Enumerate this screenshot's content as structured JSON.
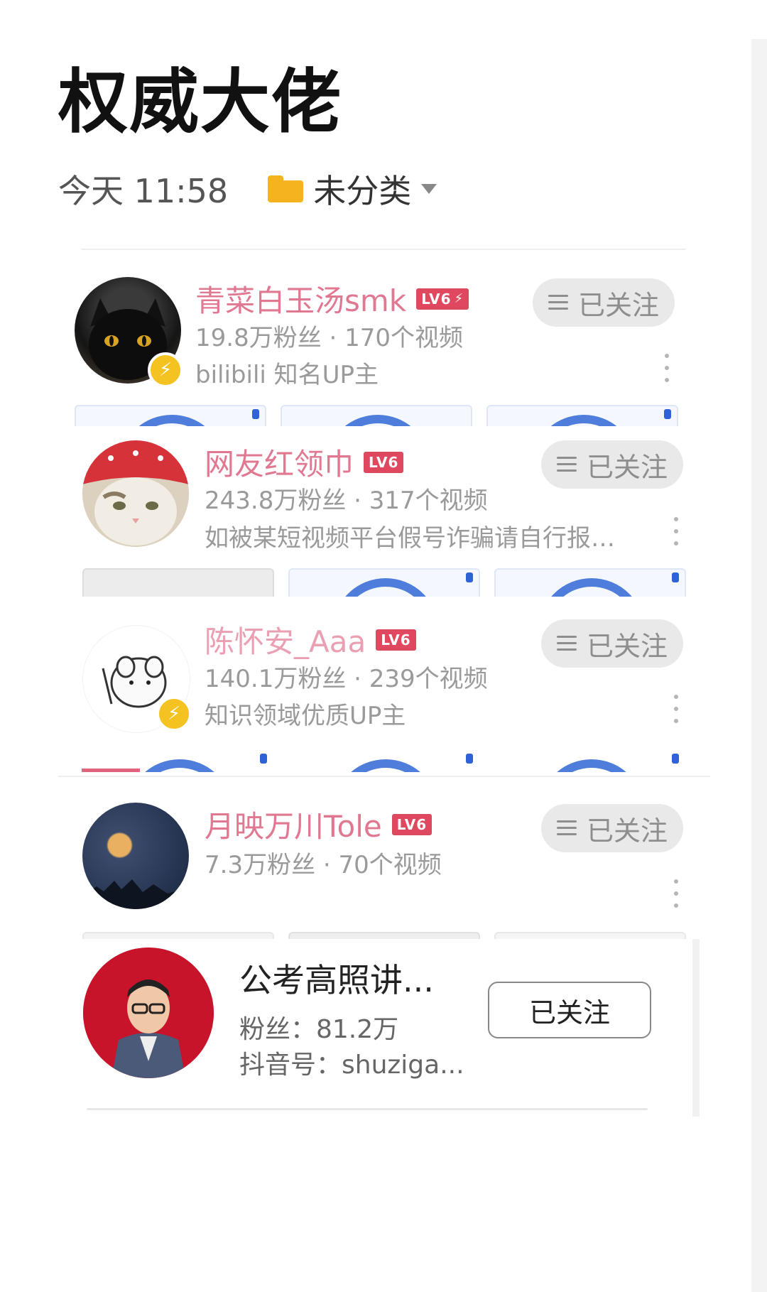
{
  "title": "权威大佬",
  "meta": {
    "time": "今天 11:58",
    "folder": "未分类"
  },
  "cards": [
    {
      "name": "青菜白玉汤smk",
      "level": "LV6",
      "stats": "19.8万粉丝 · 170个视频",
      "desc": "bilibili 知名UP主",
      "follow": "已关注"
    },
    {
      "name": "网友红领巾",
      "level": "LV6",
      "stats": "243.8万粉丝 · 317个视频",
      "desc": "如被某短视频平台假号诈骗请自行报警...",
      "follow": "已关注"
    },
    {
      "name": "陈怀安_Aaa",
      "level": "LV6",
      "stats": "140.1万粉丝 · 239个视频",
      "desc": "知识领域优质UP主",
      "follow": "已关注"
    },
    {
      "name": "月映万川Tole",
      "level": "LV6",
      "stats": "7.3万粉丝 · 70个视频",
      "follow": "已关注"
    }
  ],
  "douyin": {
    "name": "公考高照讲...",
    "fans": "粉丝：81.2万",
    "id": "抖音号：shuziga...",
    "follow": "已关注"
  },
  "colors": {
    "username": "#e17892",
    "level_badge": "#e0485f",
    "verified_bolt": "#f5c321",
    "folder": "#f5b41f",
    "thumb_arc": "#4e7ddc"
  }
}
